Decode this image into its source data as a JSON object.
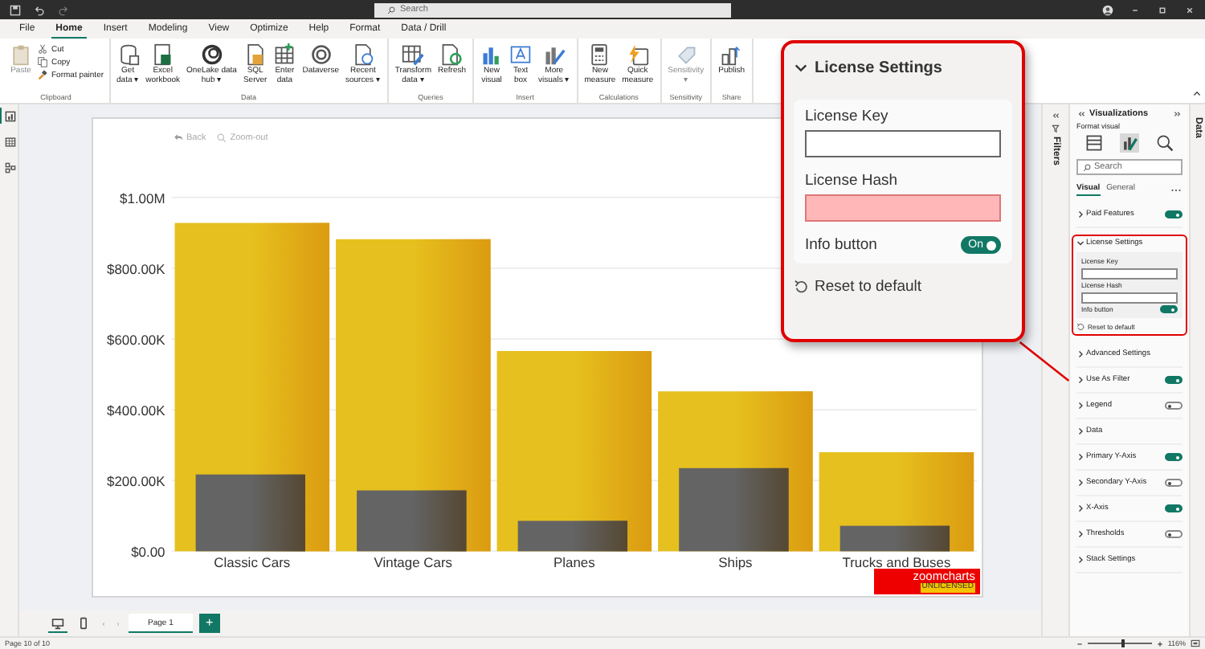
{
  "title_bar": {
    "search_placeholder": "Search"
  },
  "menu_tabs": [
    {
      "label": "File",
      "selected": false
    },
    {
      "label": "Home",
      "selected": true
    },
    {
      "label": "Insert",
      "selected": false
    },
    {
      "label": "Modeling",
      "selected": false
    },
    {
      "label": "View",
      "selected": false
    },
    {
      "label": "Optimize",
      "selected": false
    },
    {
      "label": "Help",
      "selected": false
    },
    {
      "label": "Format",
      "selected": false
    },
    {
      "label": "Data / Drill",
      "selected": false
    }
  ],
  "ribbon": [
    {
      "label": "Clipboard",
      "items": [
        {
          "label": "Paste",
          "kind": "big",
          "disabled": true
        },
        {
          "label": "Cut",
          "kind": "small",
          "disabled": false
        },
        {
          "label": "Copy",
          "kind": "small",
          "disabled": false
        },
        {
          "label": "Format painter",
          "kind": "small",
          "disabled": false
        }
      ]
    },
    {
      "label": "Data",
      "items": [
        {
          "label": "Get\ndata ▾",
          "kind": "big",
          "disabled": false
        },
        {
          "label": "Excel\nworkbook",
          "kind": "big",
          "disabled": false
        },
        {
          "label": "OneLake data\nhub ▾",
          "kind": "big",
          "disabled": false
        },
        {
          "label": "SQL\nServer",
          "kind": "big",
          "disabled": false
        },
        {
          "label": "Enter\ndata",
          "kind": "big",
          "disabled": false
        },
        {
          "label": "Dataverse",
          "kind": "big",
          "disabled": false
        },
        {
          "label": "Recent\nsources ▾",
          "kind": "big",
          "disabled": false
        }
      ]
    },
    {
      "label": "Queries",
      "items": [
        {
          "label": "Transform\ndata ▾",
          "kind": "big",
          "disabled": false
        },
        {
          "label": "Refresh",
          "kind": "big",
          "disabled": false
        }
      ]
    },
    {
      "label": "Insert",
      "items": [
        {
          "label": "New\nvisual",
          "kind": "big",
          "disabled": false
        },
        {
          "label": "Text\nbox",
          "kind": "big",
          "disabled": false
        },
        {
          "label": "More\nvisuals ▾",
          "kind": "big",
          "disabled": false
        }
      ]
    },
    {
      "label": "Calculations",
      "items": [
        {
          "label": "New\nmeasure",
          "kind": "big",
          "disabled": false
        },
        {
          "label": "Quick\nmeasure",
          "kind": "big",
          "disabled": false
        }
      ]
    },
    {
      "label": "Sensitivity",
      "items": [
        {
          "label": "Sensitivity\n▾",
          "kind": "big",
          "disabled": true
        }
      ]
    },
    {
      "label": "Share",
      "items": [
        {
          "label": "Publish",
          "kind": "big",
          "disabled": false
        }
      ]
    }
  ],
  "left_rail": [
    {
      "selected": true
    },
    {
      "selected": false
    },
    {
      "selected": false
    }
  ],
  "visual": {
    "toolbar": [
      {
        "label": "Back"
      },
      {
        "label": "Zoom-out"
      }
    ],
    "chart_data": {
      "type": "bar",
      "categories": [
        "Classic Cars",
        "Vintage Cars",
        "Planes",
        "Ships",
        "Trucks and Buses"
      ],
      "series": [
        {
          "color": "#e6c01e",
          "values": [
            928000,
            882000,
            566000,
            452000,
            280000
          ]
        },
        {
          "color": "#646464",
          "values": [
            217000,
            172000,
            86000,
            235000,
            72000
          ]
        }
      ],
      "ylim": [
        0,
        1000000
      ],
      "grid": true,
      "yticks": [
        {
          "value": 0,
          "label": "$0.00"
        },
        {
          "value": 200000,
          "label": "$200.00K"
        },
        {
          "value": 400000,
          "label": "$400.00K"
        },
        {
          "value": 600000,
          "label": "$600.00K"
        },
        {
          "value": 800000,
          "label": "$800.00K"
        },
        {
          "value": 1000000,
          "label": "$1.00M"
        }
      ]
    },
    "badge": {
      "brand": "zoomcharts",
      "note": "UNLICENSED"
    }
  },
  "page_tabs": {
    "views": [
      {
        "selected": true
      },
      {
        "selected": false
      }
    ],
    "pages": [
      {
        "label": "Page 1",
        "selected": true
      }
    ],
    "add": "+"
  },
  "filters_pane": {
    "label": "Filters"
  },
  "data_pane": {
    "label": "Data"
  },
  "visualizations": {
    "title": "Visualizations",
    "subtitle": "Format visual",
    "search_placeholder": "Search",
    "tabs": [
      {
        "label": "Visual",
        "selected": true
      },
      {
        "label": "General",
        "selected": false
      }
    ],
    "sections": [
      {
        "label": "Paid Features",
        "kind": "toggle",
        "on": true,
        "expanded": false
      },
      {
        "label": "License Settings",
        "kind": "group",
        "expanded": true,
        "highlighted": true,
        "fields": [
          {
            "label": "License Key",
            "invalid": false
          },
          {
            "label": "License Hash",
            "invalid": false
          }
        ],
        "toggle": {
          "label": "Info button",
          "on": true
        },
        "reset": "Reset to default"
      },
      {
        "label": "Advanced Settings",
        "kind": "plain",
        "expanded": false
      },
      {
        "label": "Use As Filter",
        "kind": "toggle",
        "on": true,
        "expanded": false
      },
      {
        "label": "Legend",
        "kind": "toggle",
        "on": false,
        "expanded": false
      },
      {
        "label": "Data",
        "kind": "plain",
        "expanded": false
      },
      {
        "label": "Primary Y-Axis",
        "kind": "toggle",
        "on": true,
        "expanded": false
      },
      {
        "label": "Secondary Y-Axis",
        "kind": "toggle",
        "on": false,
        "expanded": false
      },
      {
        "label": "X-Axis",
        "kind": "toggle",
        "on": true,
        "expanded": false
      },
      {
        "label": "Thresholds",
        "kind": "toggle",
        "on": false,
        "expanded": false
      },
      {
        "label": "Stack Settings",
        "kind": "plain",
        "expanded": false
      }
    ]
  },
  "popup": {
    "title": "License Settings",
    "expanded": true,
    "fields": [
      {
        "label": "License Key",
        "invalid": false
      },
      {
        "label": "License Hash",
        "invalid": true
      }
    ],
    "toggle": {
      "label": "Info button",
      "on": true,
      "text": "On"
    },
    "reset": "Reset to default"
  },
  "status_bar": {
    "page": "Page 10 of 10",
    "zoom": "116%",
    "level": 0.55
  }
}
